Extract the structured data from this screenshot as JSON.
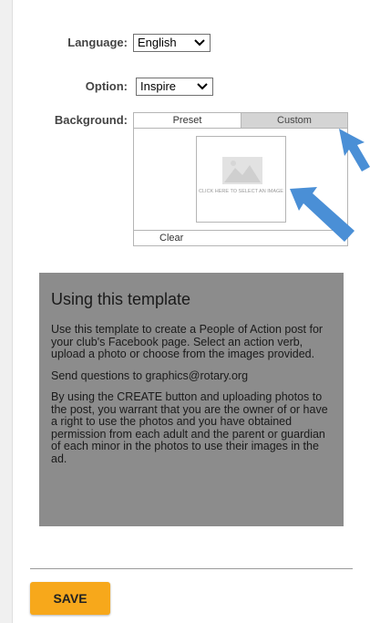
{
  "form": {
    "language_label": "Language:",
    "language_value": "English",
    "option_label": "Option:",
    "option_value": "Inspire",
    "background_label": "Background:"
  },
  "background": {
    "tabs": [
      "Preset",
      "Custom"
    ],
    "image_prompt": "CLICK HERE TO SELECT AN IMAGE",
    "clear_label": "Clear"
  },
  "info": {
    "title": "Using this template",
    "paragraphs": [
      "Use this template to create a People of Action post for your club's Facebook page. Select an action verb, upload a photo or choose from the images provided.",
      "Send questions to graphics@rotary.org",
      "By using the CREATE button and uploading photos to the post, you warrant that you are the owner of or have a right to use the photos and you have obtained permission from each adult and the parent or guardian of each minor in the photos to use their images in the ad."
    ]
  },
  "footer": {
    "save_label": "SAVE"
  },
  "colors": {
    "accent_button": "#f7a81b",
    "info_bg": "#8c8c8c",
    "arrow": "#4a8fd6"
  },
  "icons": {
    "placeholder": "image-placeholder-icon",
    "dropdown": "chevron-down-icon",
    "annotation": "arrow-pointer-icon"
  }
}
